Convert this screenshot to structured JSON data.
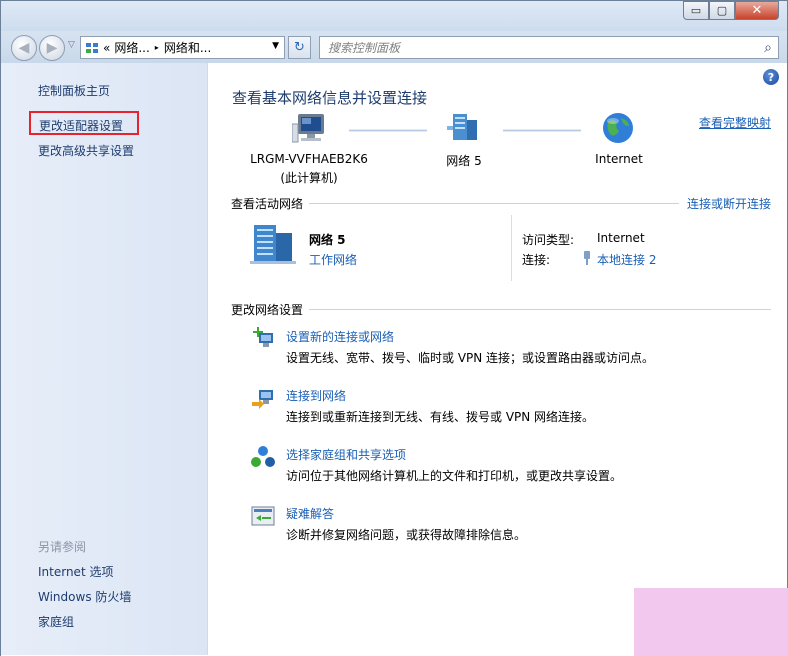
{
  "titlebar": {
    "minimize_glyph": "▭",
    "maximize_glyph": "▢",
    "close_glyph": "✕"
  },
  "navbar": {
    "back_glyph": "◀",
    "forward_glyph": "▶",
    "history_glyph": "▽",
    "address": {
      "chevrons": "«",
      "crumb1": "网络...",
      "sep": "▸",
      "crumb2": "网络和...",
      "drop": "▼"
    },
    "refresh_glyph": "↻",
    "search_placeholder": "搜索控制面板",
    "search_icon": "⌕"
  },
  "sidebar": {
    "home": "控制面板主页",
    "change_adapter": "更改适配器设置",
    "advanced_sharing": "更改高级共享设置",
    "see_also_heading": "另请参阅",
    "see_also": [
      "Internet 选项",
      "Windows 防火墙",
      "家庭组"
    ]
  },
  "main": {
    "help": "?",
    "title": "查看基本网络信息并设置连接",
    "full_map_link": "查看完整映射",
    "map": {
      "computer_name": "LRGM-VVFHAEB2K6",
      "computer_sub": "(此计算机)",
      "network": "网络  5",
      "internet": "Internet"
    },
    "active_section": {
      "title": "查看活动网络",
      "link": "连接或断开连接",
      "network_name": "网络  5",
      "network_type": "工作网络",
      "access_label": "访问类型:",
      "access_value": "Internet",
      "conn_label": "连接:",
      "conn_value": "本地连接 2"
    },
    "change_section": {
      "title": "更改网络设置",
      "tasks": [
        {
          "link": "设置新的连接或网络",
          "desc": "设置无线、宽带、拨号、临时或 VPN 连接；或设置路由器或访问点。"
        },
        {
          "link": "连接到网络",
          "desc": "连接到或重新连接到无线、有线、拨号或 VPN 网络连接。"
        },
        {
          "link": "选择家庭组和共享选项",
          "desc": "访问位于其他网络计算机上的文件和打印机，或更改共享设置。"
        },
        {
          "link": "疑难解答",
          "desc": "诊断并修复网络问题，或获得故障排除信息。"
        }
      ]
    }
  },
  "colors": {
    "link": "#1a5fb4",
    "highlight_box": "#e8232e",
    "overlay": "#f2c8ef"
  }
}
